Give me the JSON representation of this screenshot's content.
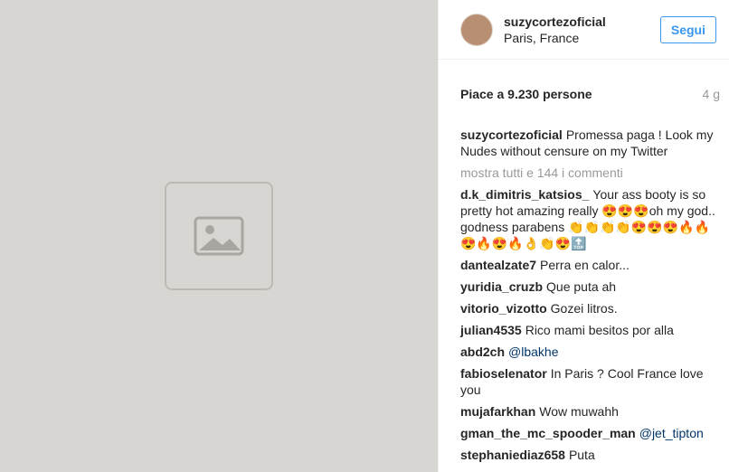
{
  "header": {
    "username": "suzycortezoficial",
    "location": "Paris, France",
    "follow_label": "Segui"
  },
  "likes": {
    "text": "Piace a 9.230 persone",
    "time": "4 g"
  },
  "caption": {
    "user": "suzycortezoficial",
    "text": "Promessa paga ! Look my Nudes without censure on my Twitter"
  },
  "view_all": "mostra tutti e 144 i commenti",
  "comments": [
    {
      "user": "d.k_dimitris_katsios_",
      "text": "Your ass booty is so pretty hot amazing really 😍😍😍oh my god.. godness parabens 👏👏👏👏😍😍😍🔥🔥😍🔥😍🔥👌👏😍🔝"
    },
    {
      "user": "dantealzate7",
      "text": "Perra en calor..."
    },
    {
      "user": "yuridia_cruzb",
      "text": "Que puta ah"
    },
    {
      "user": "vitorio_vizotto",
      "text": "Gozei litros."
    },
    {
      "user": "julian4535",
      "text": "Rico mami besitos por alla"
    },
    {
      "user": "abd2ch",
      "text": "@lbakhe"
    },
    {
      "user": "fabioselenator",
      "text": "In Paris ? Cool France love you"
    },
    {
      "user": "mujafarkhan",
      "text": "Wow muwahh"
    },
    {
      "user": "gman_the_mc_spooder_man",
      "text": "@jet_tipton"
    },
    {
      "user": "stephaniediaz658",
      "text": "Puta"
    }
  ]
}
